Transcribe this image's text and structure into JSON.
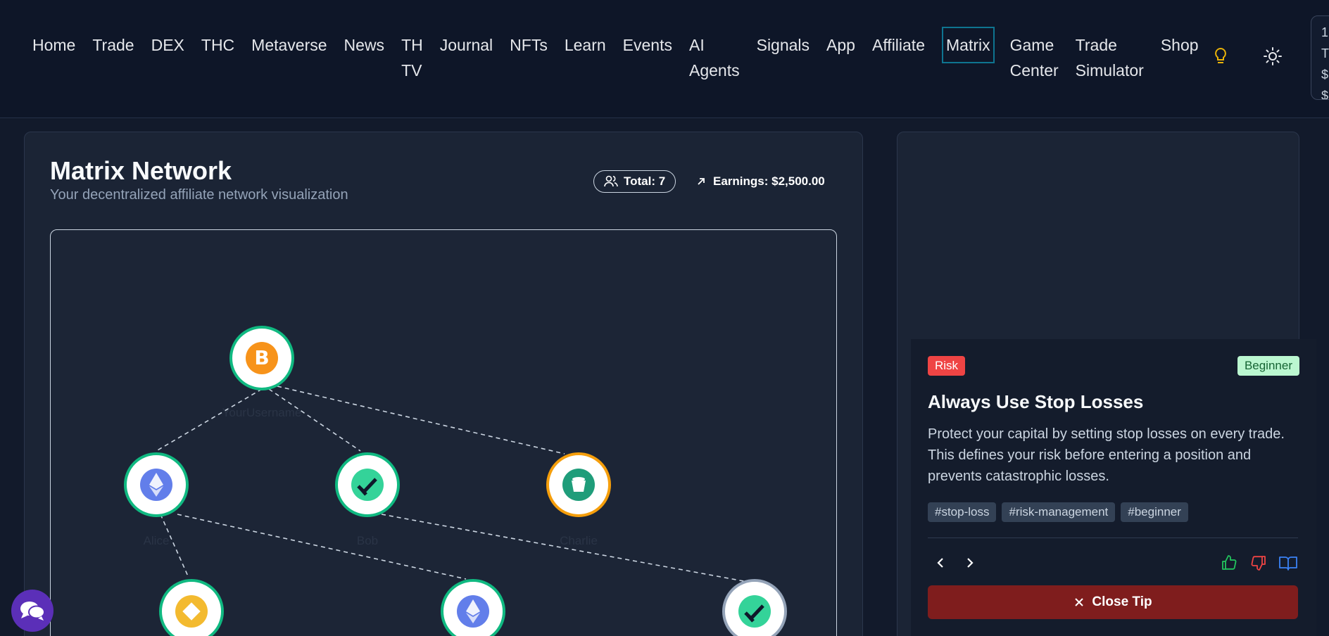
{
  "nav": {
    "items": [
      {
        "label": "Home"
      },
      {
        "label": "Trade"
      },
      {
        "label": "DEX"
      },
      {
        "label": "THC"
      },
      {
        "label": "Metaverse"
      },
      {
        "label": "News"
      },
      {
        "label": "TH\nTV"
      },
      {
        "label": "Journal"
      },
      {
        "label": "NFTs"
      },
      {
        "label": "Learn"
      },
      {
        "label": "Events"
      },
      {
        "label": "AI\nAgents"
      },
      {
        "label": "Signals"
      },
      {
        "label": "App"
      },
      {
        "label": "Affiliate"
      },
      {
        "label": "Matrix",
        "active": true
      },
      {
        "label": "Game\nCenter"
      },
      {
        "label": "Trade\nSimulator"
      },
      {
        "label": "Shop"
      }
    ],
    "icons": [
      "lightbulb-icon",
      "sun-icon"
    ],
    "cut_card_text": "1\nT\n$\n$"
  },
  "matrix": {
    "title": "Matrix Network",
    "subtitle": "Your decentralized affiliate network visualization",
    "total_label": "Total: 7",
    "earnings_label": "Earnings: $2,500.00",
    "nodes": [
      {
        "label": "YourUsername",
        "coin": "bitcoin-icon",
        "ring": "#10b981"
      },
      {
        "label": "Alice",
        "coin": "ethereum-icon",
        "ring": "#10b981"
      },
      {
        "label": "Bob",
        "coin": "check-token-icon",
        "ring": "#10b981"
      },
      {
        "label": "Charlie",
        "coin": "bucket-token-icon",
        "ring": "#f59e0b"
      },
      {
        "label": "",
        "coin": "bnb-icon",
        "ring": "#10b981"
      },
      {
        "label": "",
        "coin": "ethereum-icon",
        "ring": "#10b981"
      },
      {
        "label": "",
        "coin": "check-token-icon",
        "ring": "#94a3b8"
      }
    ]
  },
  "tip": {
    "category": "Risk",
    "level": "Beginner",
    "title": "Always Use Stop Losses",
    "body": "Protect your capital by setting stop losses on every trade. This defines your risk before entering a position and prevents catastrophic losses.",
    "tags": [
      "#stop-loss",
      "#risk-management",
      "#beginner"
    ],
    "close_label": "Close Tip"
  },
  "colors": {
    "accent": "#0e7490",
    "danger": "#ef4444",
    "close": "#7f1d1d",
    "chat": "#5b2fb8"
  }
}
